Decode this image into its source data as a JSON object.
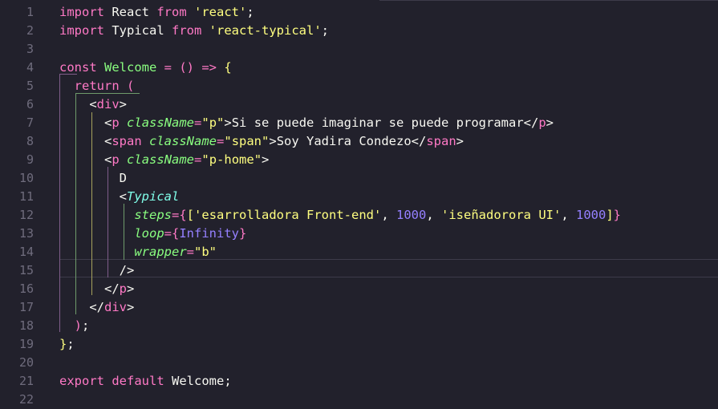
{
  "editor": {
    "line_numbers": [
      "1",
      "2",
      "3",
      "4",
      "5",
      "6",
      "7",
      "8",
      "9",
      "10",
      "11",
      "12",
      "13",
      "14",
      "15",
      "16",
      "17",
      "18",
      "19",
      "20",
      "21",
      "22"
    ],
    "lines": [
      [
        {
          "t": "import",
          "c": "kw"
        },
        {
          "t": " React ",
          "c": "var"
        },
        {
          "t": "from",
          "c": "kw"
        },
        {
          "t": " ",
          "c": "var"
        },
        {
          "t": "'react'",
          "c": "str"
        },
        {
          "t": ";",
          "c": "punct"
        }
      ],
      [
        {
          "t": "import",
          "c": "kw"
        },
        {
          "t": " Typical ",
          "c": "var"
        },
        {
          "t": "from",
          "c": "kw"
        },
        {
          "t": " ",
          "c": "var"
        },
        {
          "t": "'react-typical'",
          "c": "str"
        },
        {
          "t": ";",
          "c": "punct"
        }
      ],
      [],
      [
        {
          "t": "const",
          "c": "kw"
        },
        {
          "t": " ",
          "c": "var"
        },
        {
          "t": "Welcome",
          "c": "ident"
        },
        {
          "t": " = ",
          "c": "op"
        },
        {
          "t": "()",
          "c": "paren"
        },
        {
          "t": " => ",
          "c": "op"
        },
        {
          "t": "{",
          "c": "str"
        }
      ],
      [
        {
          "t": "  ",
          "c": "var"
        },
        {
          "t": "return",
          "c": "kw"
        },
        {
          "t": " ",
          "c": "var"
        },
        {
          "t": "(",
          "c": "paren"
        }
      ],
      [
        {
          "t": "    ",
          "c": "var"
        },
        {
          "t": "<",
          "c": "punct"
        },
        {
          "t": "div",
          "c": "tag"
        },
        {
          "t": ">",
          "c": "punct"
        }
      ],
      [
        {
          "t": "      ",
          "c": "var"
        },
        {
          "t": "<",
          "c": "punct"
        },
        {
          "t": "p",
          "c": "tag"
        },
        {
          "t": " ",
          "c": "var"
        },
        {
          "t": "className",
          "c": "attr"
        },
        {
          "t": "=",
          "c": "op"
        },
        {
          "t": "\"p\"",
          "c": "str"
        },
        {
          "t": ">Si se puede imaginar se puede programar</",
          "c": "punct"
        },
        {
          "t": "p",
          "c": "tag"
        },
        {
          "t": ">",
          "c": "punct"
        }
      ],
      [
        {
          "t": "      ",
          "c": "var"
        },
        {
          "t": "<",
          "c": "punct"
        },
        {
          "t": "span",
          "c": "tag"
        },
        {
          "t": " ",
          "c": "var"
        },
        {
          "t": "className",
          "c": "attr"
        },
        {
          "t": "=",
          "c": "op"
        },
        {
          "t": "\"span\"",
          "c": "str"
        },
        {
          "t": ">Soy Yadira Condezo</",
          "c": "punct"
        },
        {
          "t": "span",
          "c": "tag"
        },
        {
          "t": ">",
          "c": "punct"
        }
      ],
      [
        {
          "t": "      ",
          "c": "var"
        },
        {
          "t": "<",
          "c": "punct"
        },
        {
          "t": "p",
          "c": "tag"
        },
        {
          "t": " ",
          "c": "var"
        },
        {
          "t": "className",
          "c": "attr"
        },
        {
          "t": "=",
          "c": "op"
        },
        {
          "t": "\"p-home\"",
          "c": "str"
        },
        {
          "t": ">",
          "c": "punct"
        }
      ],
      [
        {
          "t": "        D",
          "c": "var"
        }
      ],
      [
        {
          "t": "        ",
          "c": "var"
        },
        {
          "t": "<",
          "c": "punct"
        },
        {
          "t": "Typical",
          "c": "comp"
        }
      ],
      [
        {
          "t": "          ",
          "c": "var"
        },
        {
          "t": "steps",
          "c": "attr"
        },
        {
          "t": "=",
          "c": "op"
        },
        {
          "t": "{",
          "c": "brace"
        },
        {
          "t": "[",
          "c": "str"
        },
        {
          "t": "'esarrolladora Front-end'",
          "c": "str"
        },
        {
          "t": ", ",
          "c": "punct"
        },
        {
          "t": "1000",
          "c": "num"
        },
        {
          "t": ", ",
          "c": "punct"
        },
        {
          "t": "'iseñadorora UI'",
          "c": "str"
        },
        {
          "t": ", ",
          "c": "punct"
        },
        {
          "t": "1000",
          "c": "num"
        },
        {
          "t": "]",
          "c": "str"
        },
        {
          "t": "}",
          "c": "brace"
        }
      ],
      [
        {
          "t": "          ",
          "c": "var"
        },
        {
          "t": "loop",
          "c": "attr"
        },
        {
          "t": "=",
          "c": "op"
        },
        {
          "t": "{",
          "c": "brace"
        },
        {
          "t": "Infinity",
          "c": "num"
        },
        {
          "t": "}",
          "c": "brace"
        }
      ],
      [
        {
          "t": "          ",
          "c": "var"
        },
        {
          "t": "wrapper",
          "c": "attr"
        },
        {
          "t": "=",
          "c": "op"
        },
        {
          "t": "\"b\"",
          "c": "str"
        }
      ],
      [
        {
          "t": "        ",
          "c": "var"
        },
        {
          "t": "/>",
          "c": "punct"
        }
      ],
      [
        {
          "t": "      ",
          "c": "var"
        },
        {
          "t": "</",
          "c": "punct"
        },
        {
          "t": "p",
          "c": "tag"
        },
        {
          "t": ">",
          "c": "punct"
        }
      ],
      [
        {
          "t": "    ",
          "c": "var"
        },
        {
          "t": "</",
          "c": "punct"
        },
        {
          "t": "div",
          "c": "tag"
        },
        {
          "t": ">",
          "c": "punct"
        }
      ],
      [
        {
          "t": "  ",
          "c": "var"
        },
        {
          "t": ")",
          "c": "paren"
        },
        {
          "t": ";",
          "c": "punct"
        }
      ],
      [
        {
          "t": "}",
          "c": "str"
        },
        {
          "t": ";",
          "c": "punct"
        }
      ],
      [],
      [
        {
          "t": "export",
          "c": "kw"
        },
        {
          "t": " ",
          "c": "var"
        },
        {
          "t": "default",
          "c": "kw"
        },
        {
          "t": " Welcome;",
          "c": "var"
        }
      ],
      []
    ]
  },
  "colors": {
    "background": "#22212c",
    "line_number": "#6f6c7d",
    "keyword": "#ff79c6",
    "string": "#ffff80",
    "attribute": "#8aff80",
    "component": "#80ffea",
    "number": "#9580ff"
  }
}
